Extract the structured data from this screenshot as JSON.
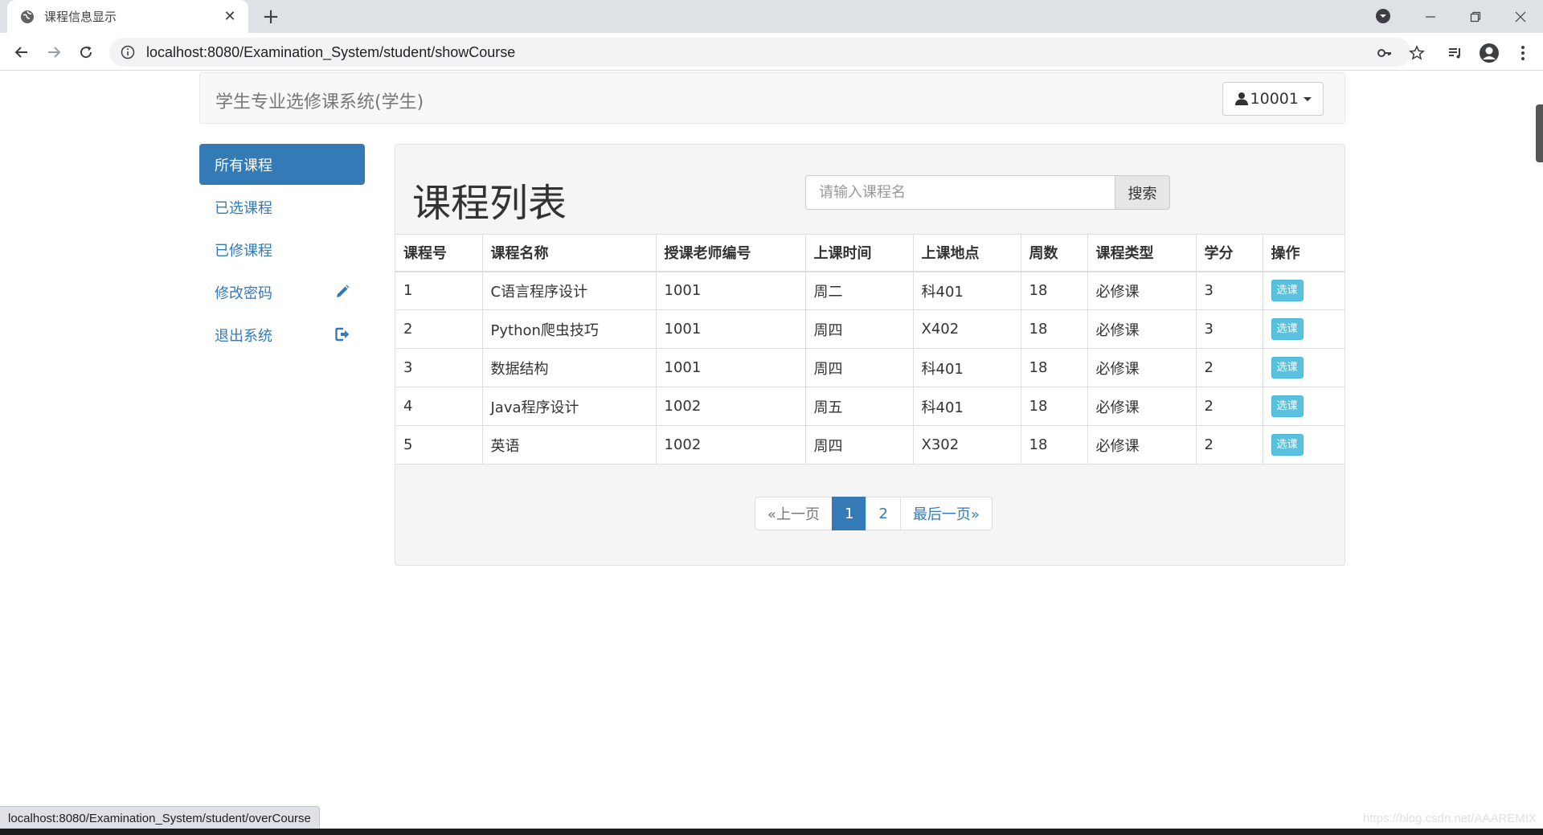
{
  "browser": {
    "tab_title": "课程信息显示",
    "url": "localhost:8080/Examination_System/student/showCourse"
  },
  "navbar": {
    "brand": "学生专业选修课系统(学生)",
    "user": "10001"
  },
  "sidebar": {
    "items": [
      {
        "label": "所有课程",
        "active": true
      },
      {
        "label": "已选课程"
      },
      {
        "label": "已修课程"
      },
      {
        "label": "修改密码",
        "icon": "pencil-icon"
      },
      {
        "label": "退出系统",
        "icon": "logout-icon"
      }
    ]
  },
  "main": {
    "title": "课程列表",
    "search": {
      "placeholder": "请输入课程名",
      "button": "搜索"
    },
    "table": {
      "headers": [
        "课程号",
        "课程名称",
        "授课老师编号",
        "上课时间",
        "上课地点",
        "周数",
        "课程类型",
        "学分",
        "操作"
      ],
      "rows": [
        [
          "1",
          "C语言程序设计",
          "1001",
          "周二",
          "科401",
          "18",
          "必修课",
          "3"
        ],
        [
          "2",
          "Python爬虫技巧",
          "1001",
          "周四",
          "X402",
          "18",
          "必修课",
          "3"
        ],
        [
          "3",
          "数据结构",
          "1001",
          "周四",
          "科401",
          "18",
          "必修课",
          "2"
        ],
        [
          "4",
          "Java程序设计",
          "1002",
          "周五",
          "科401",
          "18",
          "必修课",
          "2"
        ],
        [
          "5",
          "英语",
          "1002",
          "周四",
          "X302",
          "18",
          "必修课",
          "2"
        ]
      ],
      "action_label": "选课"
    },
    "pagination": {
      "prev": "«上一页",
      "pages": [
        "1",
        "2"
      ],
      "current": "1",
      "last": "最后一页»"
    }
  },
  "status_url": "localhost:8080/Examination_System/student/overCourse",
  "watermark": "https://blog.csdn.net/AAAREMIX",
  "colors": {
    "primary": "#337ab7",
    "info": "#5bc0de",
    "chrome": "#dee1e6"
  }
}
